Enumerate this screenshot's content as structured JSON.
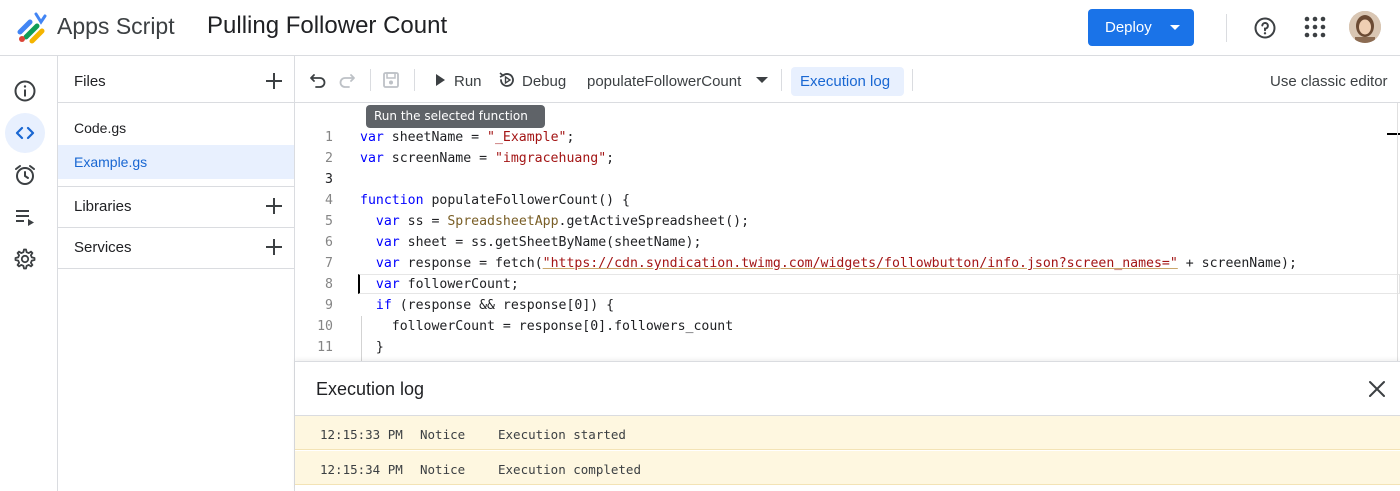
{
  "header": {
    "app_name": "Apps Script",
    "project_title": "Pulling Follower Count",
    "deploy_label": "Deploy",
    "icons": [
      "apps-script-logo",
      "help-icon",
      "google-apps-icon",
      "user-avatar"
    ]
  },
  "rail": {
    "items": [
      {
        "name": "overview",
        "icon": "info-icon",
        "active": false
      },
      {
        "name": "editor",
        "icon": "code-icon",
        "active": true
      },
      {
        "name": "triggers",
        "icon": "alarm-clock-icon",
        "active": false
      },
      {
        "name": "executions",
        "icon": "playlist-play-icon",
        "active": false
      },
      {
        "name": "project-settings",
        "icon": "gear-icon",
        "active": false
      }
    ]
  },
  "files_panel": {
    "files_label": "Files",
    "files": [
      {
        "name": "Code.gs",
        "selected": false
      },
      {
        "name": "Example.gs",
        "selected": true
      }
    ],
    "libraries_label": "Libraries",
    "services_label": "Services"
  },
  "toolbar": {
    "run_label": "Run",
    "debug_label": "Debug",
    "function_select": "populateFollowerCount",
    "execution_log_label": "Execution log",
    "classic_editor_label": "Use classic editor",
    "tooltip": "Run the selected function"
  },
  "editor": {
    "current_line": 3,
    "lines": [
      {
        "num": "1",
        "text": "var sheetName = \"_Example\";"
      },
      {
        "num": "2",
        "text": "var screenName = \"imgracehuang\";"
      },
      {
        "num": "3",
        "text": ""
      },
      {
        "num": "4",
        "text": "function populateFollowerCount() {"
      },
      {
        "num": "5",
        "text": "  var ss = SpreadsheetApp.getActiveSpreadsheet();"
      },
      {
        "num": "6",
        "text": "  var sheet = ss.getSheetByName(sheetName);"
      },
      {
        "num": "7",
        "text": "  var response = fetch(\"https://cdn.syndication.twimg.com/widgets/followbutton/info.json?screen_names=\" + screenName);"
      },
      {
        "num": "8",
        "text": "  var followerCount;"
      },
      {
        "num": "9",
        "text": "  if (response && response[0]) {"
      },
      {
        "num": "10",
        "text": "    followerCount = response[0].followers_count"
      },
      {
        "num": "11",
        "text": "  }"
      }
    ]
  },
  "execution_log": {
    "title": "Execution log",
    "entries": [
      {
        "time": "12:15:33 PM",
        "level": "Notice",
        "message": "Execution started"
      },
      {
        "time": "12:15:34 PM",
        "level": "Notice",
        "message": "Execution completed"
      }
    ]
  },
  "colors": {
    "primary": "#1a73e8",
    "selected_bg": "#e8f0fe",
    "log_row_bg": "#fef7e0",
    "keyword": "#0000ff",
    "string": "#a31515"
  }
}
